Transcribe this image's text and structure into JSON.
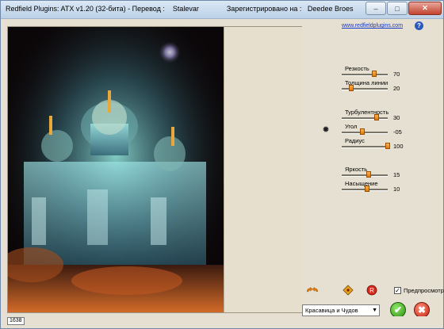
{
  "window": {
    "title": "Redfield Plugins: ATX v1.20 (32-бита) - Перевод :    Stalevar              Зарегистрировано на :   Deedee Broes",
    "minimize_icon": "minimize-icon",
    "maximize_icon": "maximize-icon",
    "close_icon": "close-icon"
  },
  "header": {
    "link_text": "www.redfieldplugins.com",
    "help_label": "?"
  },
  "sliders": [
    {
      "label": "Резкость",
      "value": "70",
      "fraction": 0.7
    },
    {
      "label": "Толщина линии",
      "value": "20",
      "fraction": 0.2
    },
    {
      "label": "Турбулентность",
      "value": "30",
      "fraction": 0.75
    },
    {
      "label": "Угол",
      "value": "-05",
      "fraction": 0.45
    },
    {
      "label": "Радиус",
      "value": "100",
      "fraction": 1.0
    },
    {
      "label": "Яркость",
      "value": "15",
      "fraction": 0.58
    },
    {
      "label": "Насыщение",
      "value": "10",
      "fraction": 0.55
    }
  ],
  "tools": {
    "undo_redo_icon": "undo-redo-arrows-icon",
    "randomize_icon": "diamond-randomize-icon",
    "reset_icon": "reset-circle-icon",
    "preview_checked": true,
    "preview_label": "Предпросмотр"
  },
  "footer": {
    "preset_value": "Красавица и Чудов",
    "ok_label": "✔",
    "cancel_label": "✖",
    "status_text": "1638"
  },
  "colors": {
    "slider_thumb": "#f08c1a",
    "ok_green": "#2d8f12",
    "cancel_red": "#c3230b",
    "link_blue": "#1a39c8"
  }
}
